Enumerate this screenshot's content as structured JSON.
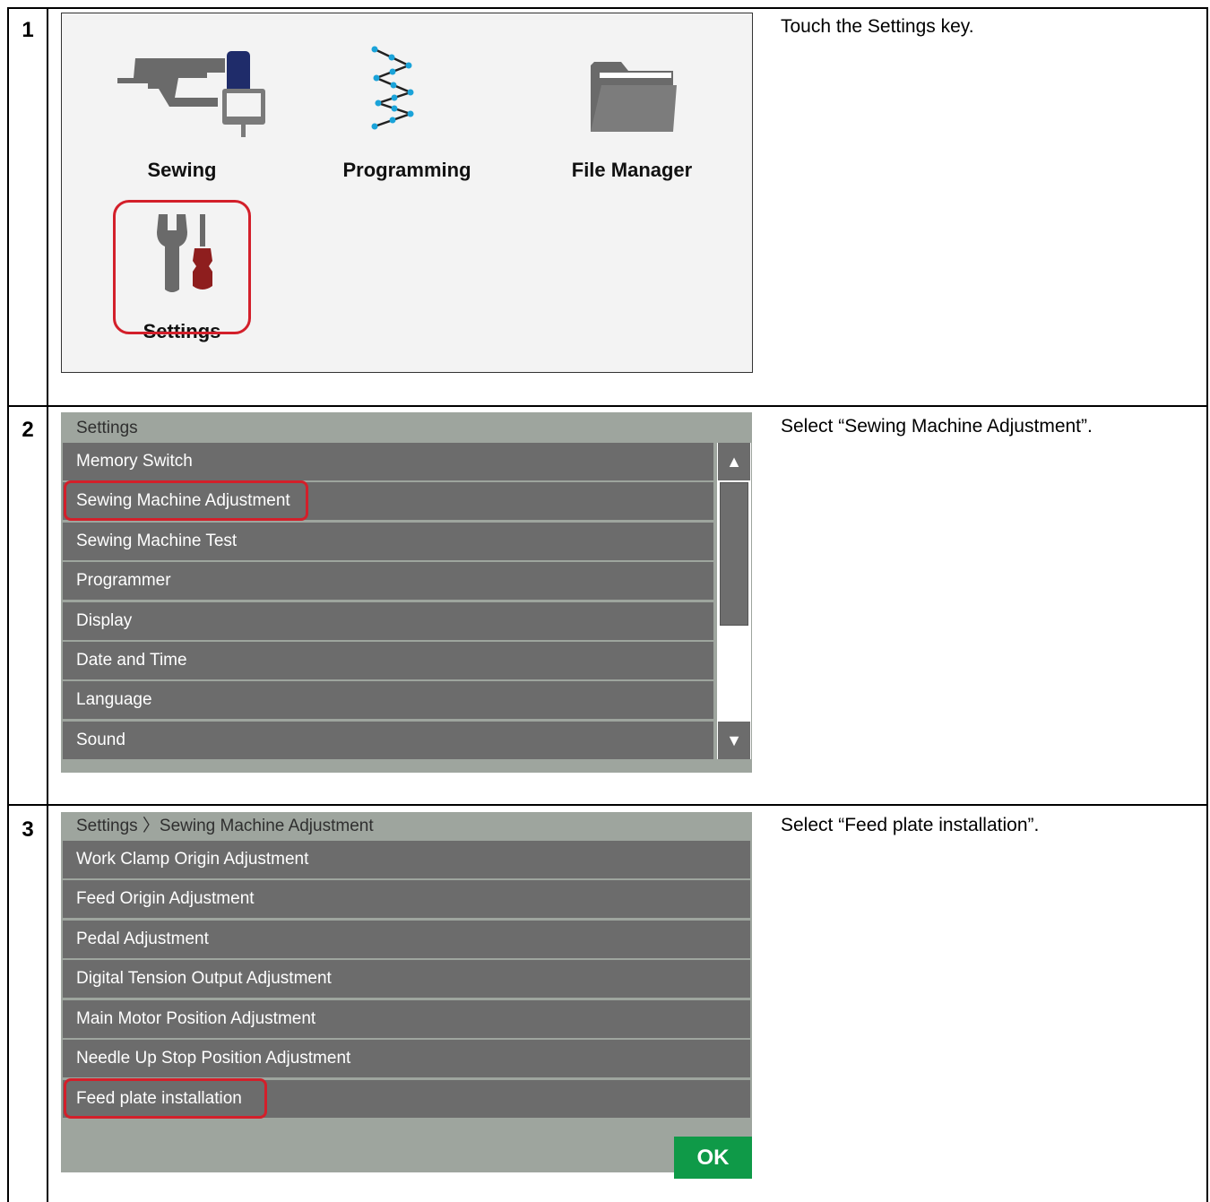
{
  "steps": [
    {
      "number": "1",
      "instruction": "Touch the Settings key."
    },
    {
      "number": "2",
      "instruction": "Select “Sewing Machine Adjustment”."
    },
    {
      "number": "3",
      "instruction": "Select “Feed plate installation”."
    }
  ],
  "home": {
    "tiles": [
      {
        "label": "Sewing",
        "icon": "sewing-machine-icon"
      },
      {
        "label": "Programming",
        "icon": "zigzag-programming-icon"
      },
      {
        "label": "File Manager",
        "icon": "folder-icon"
      },
      {
        "label": "Settings",
        "icon": "wrench-screwdriver-icon"
      }
    ],
    "highlight_color": "#d31f2a"
  },
  "settings_screen": {
    "title": "Settings",
    "items": [
      "Memory Switch",
      "Sewing Machine Adjustment",
      "Sewing Machine Test",
      "Programmer",
      "Display",
      "Date and Time",
      "Language",
      "Sound"
    ],
    "highlighted_item": "Sewing Machine Adjustment",
    "scroll_up": "▲",
    "scroll_down": "▼"
  },
  "adjust_screen": {
    "title": "Settings 〉Sewing Machine Adjustment",
    "items": [
      "Work Clamp Origin Adjustment",
      "Feed Origin Adjustment",
      "Pedal Adjustment",
      "Digital Tension Output Adjustment",
      "Main Motor Position Adjustment",
      "Needle Up Stop Position Adjustment",
      "Feed plate installation"
    ],
    "highlighted_item": "Feed plate installation",
    "ok_label": "OK"
  },
  "colors": {
    "screen_bg": "#9ea59e",
    "row_bg": "#6c6c6c",
    "ok_green": "#0f9a48",
    "highlight_red": "#d31f2a"
  }
}
